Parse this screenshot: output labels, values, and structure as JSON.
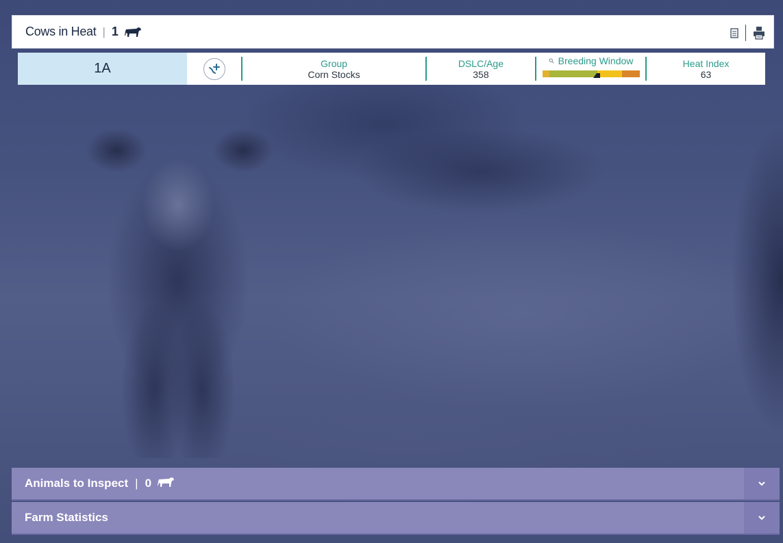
{
  "header": {
    "title": "Cows in Heat",
    "separator": "|",
    "count": "1",
    "cow_icon": "cow-icon",
    "actions": [
      {
        "name": "document-icon"
      },
      {
        "name": "printer-icon"
      }
    ]
  },
  "animal_row": {
    "id": "1A",
    "action_icon": "add-treatment-icon",
    "group_label": "Group",
    "group_value": "Corn Stocks",
    "dslc_label": "DSLC/Age",
    "dslc_value": "358",
    "breeding_window_label": "Breeding Window",
    "breeding_window_icon": "search-icon",
    "breeding_window_colors": [
      "#e0b22e",
      "#a8b63a",
      "#f2c21a",
      "#d9862a"
    ],
    "heat_index_label": "Heat Index",
    "heat_index_value": "63"
  },
  "panels": {
    "animals_to_inspect": {
      "title": "Animals to Inspect",
      "separator": "|",
      "count": "0",
      "icon": "cow-icon",
      "toggle_icon": "chevron-down-icon"
    },
    "farm_statistics": {
      "title": "Farm Statistics",
      "toggle_icon": "chevron-down-icon"
    }
  },
  "colors": {
    "accent_teal": "#2a9a8a",
    "panel_purple": "#8a87bb",
    "id_highlight": "#cfe6f4",
    "text_dark": "#1c2a44"
  }
}
